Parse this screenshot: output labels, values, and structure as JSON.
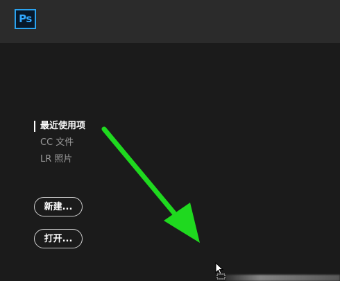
{
  "app": {
    "logo_text": "Ps",
    "logo_icon": "photoshop-logo-icon",
    "accent_color": "#31a8ff"
  },
  "sidebar": {
    "items": [
      {
        "label": "最近使用项",
        "active": true
      },
      {
        "label": "CC 文件",
        "active": false
      },
      {
        "label": "LR 照片",
        "active": false
      }
    ]
  },
  "actions": {
    "new_label": "新建...",
    "open_label": "打开..."
  },
  "annotation": {
    "arrow_icon": "green-arrow-icon",
    "arrow_color": "#1fd91f"
  },
  "cursor": {
    "icon": "mouse-pointer-icon"
  }
}
